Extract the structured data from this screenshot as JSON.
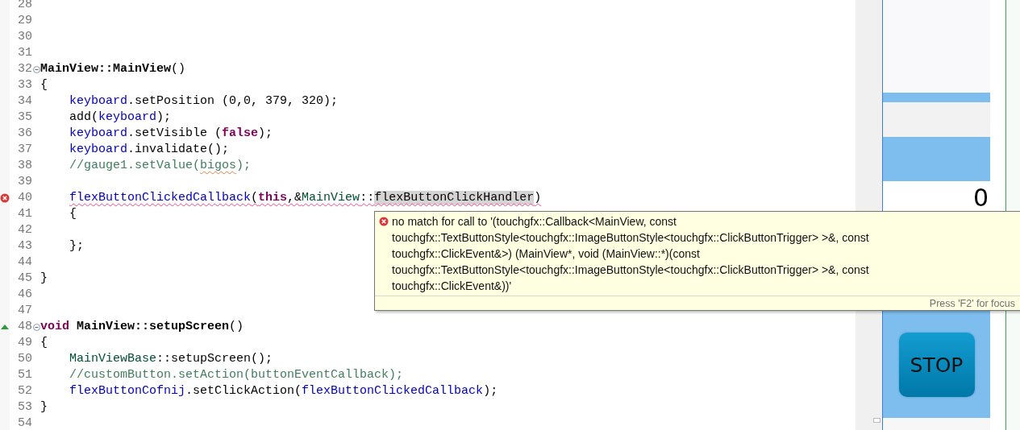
{
  "editor": {
    "lines": [
      {
        "number": "28",
        "error": false,
        "override": false,
        "fold": false
      },
      {
        "number": "29",
        "error": false,
        "override": false,
        "fold": false
      },
      {
        "number": "30",
        "error": false,
        "override": false,
        "fold": false
      },
      {
        "number": "31",
        "error": false,
        "override": false,
        "fold": false
      },
      {
        "number": "32",
        "error": false,
        "override": false,
        "fold": true,
        "tokens": [
          {
            "text": "MainView::MainView",
            "kind": "definition"
          },
          {
            "text": "()",
            "kind": "plain"
          }
        ]
      },
      {
        "number": "33",
        "error": false,
        "override": false,
        "fold": false,
        "tokens": [
          {
            "text": "{",
            "kind": "plain"
          }
        ]
      },
      {
        "number": "34",
        "error": false,
        "override": false,
        "fold": false,
        "tokens": [
          {
            "text": "    keyboard",
            "kind": "field"
          },
          {
            "text": ".setPosition (0,0, 379, 320);",
            "kind": "plain"
          }
        ]
      },
      {
        "number": "35",
        "error": false,
        "override": false,
        "fold": false,
        "tokens": [
          {
            "text": "    add(",
            "kind": "plain"
          },
          {
            "text": "keyboard",
            "kind": "field"
          },
          {
            "text": ");",
            "kind": "plain"
          }
        ]
      },
      {
        "number": "36",
        "error": false,
        "override": false,
        "fold": false,
        "tokens": [
          {
            "text": "    keyboard",
            "kind": "field"
          },
          {
            "text": ".setVisible (",
            "kind": "plain"
          },
          {
            "text": "false",
            "kind": "keyword"
          },
          {
            "text": ");",
            "kind": "plain"
          }
        ]
      },
      {
        "number": "37",
        "error": false,
        "override": false,
        "fold": false,
        "tokens": [
          {
            "text": "    keyboard",
            "kind": "field"
          },
          {
            "text": ".invalidate();",
            "kind": "plain"
          }
        ]
      },
      {
        "number": "38",
        "error": false,
        "override": false,
        "fold": false,
        "tokens": [
          {
            "text": "    //gauge1.setValue(",
            "kind": "comment",
            "underlined": false
          },
          {
            "text": "bigos",
            "kind": "comment",
            "underlined": true
          },
          {
            "text": ");",
            "kind": "comment",
            "underlined": false
          }
        ]
      },
      {
        "number": "39",
        "error": false,
        "override": false,
        "fold": false
      },
      {
        "number": "40",
        "error": true,
        "override": false,
        "fold": false,
        "tokens": [
          {
            "text": "    flexButtonClickedCallback",
            "kind": "field",
            "underlined": true,
            "highlighted": false
          },
          {
            "text": "(",
            "kind": "plain",
            "underlined": true,
            "highlighted": false
          },
          {
            "text": "this",
            "kind": "keyword",
            "underlined": true,
            "highlighted": false
          },
          {
            "text": ",&",
            "kind": "plain",
            "underlined": true,
            "highlighted": false
          },
          {
            "text": "MainView",
            "kind": "class",
            "underlined": true,
            "highlighted": false
          },
          {
            "text": "::",
            "kind": "plain",
            "underlined": true,
            "highlighted": false
          },
          {
            "text": "flexButtonClickHandler",
            "kind": "plain",
            "underlined": true,
            "highlighted": true
          },
          {
            "text": ")",
            "kind": "plain",
            "underlined": true,
            "highlighted": false
          }
        ]
      },
      {
        "number": "41",
        "error": false,
        "override": false,
        "fold": false,
        "tokens": [
          {
            "text": "    {",
            "kind": "plain"
          }
        ]
      },
      {
        "number": "42",
        "error": false,
        "override": false,
        "fold": false
      },
      {
        "number": "43",
        "error": false,
        "override": false,
        "fold": false,
        "tokens": [
          {
            "text": "    };",
            "kind": "plain"
          }
        ]
      },
      {
        "number": "44",
        "error": false,
        "override": false,
        "fold": false
      },
      {
        "number": "45",
        "error": false,
        "override": false,
        "fold": false,
        "tokens": [
          {
            "text": "}",
            "kind": "plain"
          }
        ]
      },
      {
        "number": "46",
        "error": false,
        "override": false,
        "fold": false
      },
      {
        "number": "47",
        "error": false,
        "override": false,
        "fold": false
      },
      {
        "number": "48",
        "error": false,
        "override": true,
        "fold": true,
        "tokens": [
          {
            "text": "void",
            "kind": "keyword"
          },
          {
            "text": " MainView::setupScreen",
            "kind": "definition"
          },
          {
            "text": "()",
            "kind": "plain"
          }
        ]
      },
      {
        "number": "49",
        "error": false,
        "override": false,
        "fold": false,
        "tokens": [
          {
            "text": "{",
            "kind": "plain"
          }
        ]
      },
      {
        "number": "50",
        "error": false,
        "override": false,
        "fold": false,
        "tokens": [
          {
            "text": "    MainViewBase",
            "kind": "class"
          },
          {
            "text": "::setupScreen();",
            "kind": "plain"
          }
        ]
      },
      {
        "number": "51",
        "error": false,
        "override": false,
        "fold": false,
        "tokens": [
          {
            "text": "    //customButton.setAction(buttonEventCallback);",
            "kind": "comment"
          }
        ]
      },
      {
        "number": "52",
        "error": false,
        "override": false,
        "fold": false,
        "tokens": [
          {
            "text": "    flexButtonCofnij",
            "kind": "field"
          },
          {
            "text": ".setClickAction(",
            "kind": "plain"
          },
          {
            "text": "flexButtonClickedCallback",
            "kind": "field"
          },
          {
            "text": ");",
            "kind": "plain"
          }
        ]
      },
      {
        "number": "53",
        "error": false,
        "override": false,
        "fold": false,
        "tokens": [
          {
            "text": "}",
            "kind": "plain"
          }
        ]
      },
      {
        "number": "54",
        "error": false,
        "override": false,
        "fold": false
      }
    ]
  },
  "tooltip": {
    "message_lines": [
      "no match for call to '(touchgfx::Callback<MainView, const",
      "touchgfx::TextButtonStyle<touchgfx::ImageButtonStyle<touchgfx::ClickButtonTrigger> >&, const",
      "touchgfx::ClickEvent&>) (MainView*, void (MainView::*)(const",
      "touchgfx::TextButtonStyle<touchgfx::ImageButtonStyle<touchgfx::ClickButtonTrigger> >&, const",
      "touchgfx::ClickEvent&))'"
    ],
    "hint": "Press 'F2' for focus"
  },
  "preview": {
    "value": "0",
    "button": "STOP"
  }
}
